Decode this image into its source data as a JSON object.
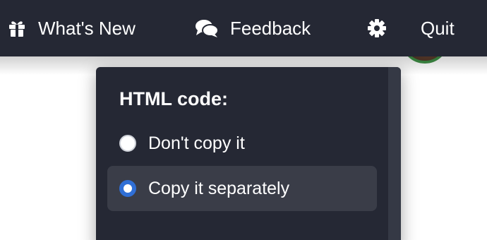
{
  "toolbar": {
    "whats_new_label": "What's New",
    "feedback_label": "Feedback",
    "quit_label": "Quit",
    "icons": {
      "whats_new": "gift-icon",
      "feedback": "chat-bubbles-icon",
      "settings": "gear-icon"
    },
    "background_color": "#252834"
  },
  "popup": {
    "heading": "HTML code:",
    "options": [
      {
        "label": "Don't copy it",
        "selected": false
      },
      {
        "label": "Copy it separately",
        "selected": true
      }
    ],
    "accent_color": "#2f6fd6",
    "background_color": "#252834"
  }
}
